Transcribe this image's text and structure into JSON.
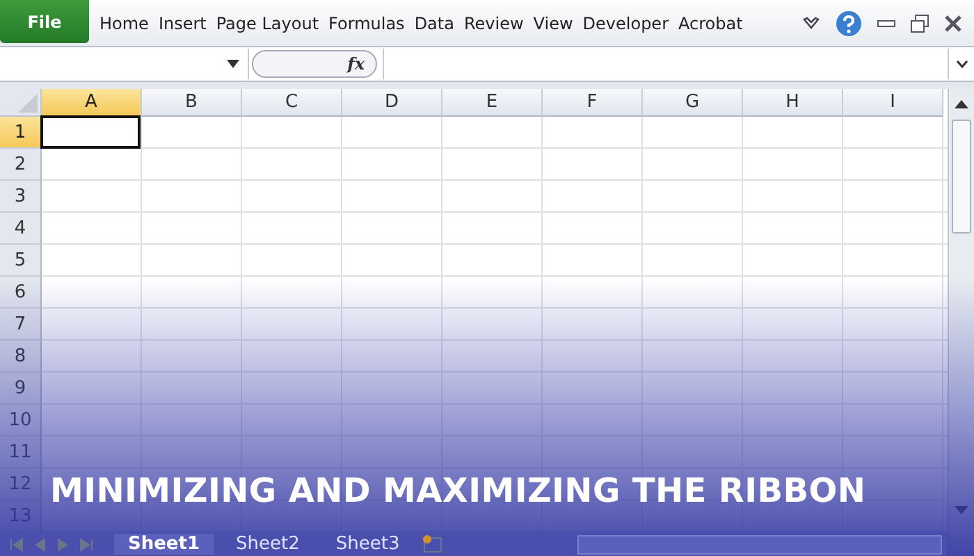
{
  "menu": {
    "file": "File",
    "tabs": [
      "Home",
      "Insert",
      "Page Layout",
      "Formulas",
      "Data",
      "Review",
      "View",
      "Developer",
      "Acrobat"
    ]
  },
  "formula_bar": {
    "function_label": "fx"
  },
  "columns": [
    {
      "label": "A",
      "selected": true
    },
    {
      "label": "B",
      "selected": false
    },
    {
      "label": "C",
      "selected": false
    },
    {
      "label": "D",
      "selected": false
    },
    {
      "label": "E",
      "selected": false
    },
    {
      "label": "F",
      "selected": false
    },
    {
      "label": "G",
      "selected": false
    },
    {
      "label": "H",
      "selected": false
    },
    {
      "label": "I",
      "selected": false
    }
  ],
  "rows": [
    {
      "label": "1",
      "selected": true
    },
    {
      "label": "2",
      "selected": false
    },
    {
      "label": "3",
      "selected": false
    },
    {
      "label": "4",
      "selected": false
    },
    {
      "label": "5",
      "selected": false
    },
    {
      "label": "6",
      "selected": false
    },
    {
      "label": "7",
      "selected": false
    },
    {
      "label": "8",
      "selected": false
    },
    {
      "label": "9",
      "selected": false
    },
    {
      "label": "10",
      "selected": false
    },
    {
      "label": "11",
      "selected": false
    },
    {
      "label": "12",
      "selected": false
    },
    {
      "label": "13",
      "selected": false
    }
  ],
  "sheets": [
    {
      "label": "Sheet1",
      "selected": true
    },
    {
      "label": "Sheet2",
      "selected": false
    },
    {
      "label": "Sheet3",
      "selected": false
    }
  ],
  "banner_title": "MINIMIZING AND MAXIMIZING THE RIBBON"
}
